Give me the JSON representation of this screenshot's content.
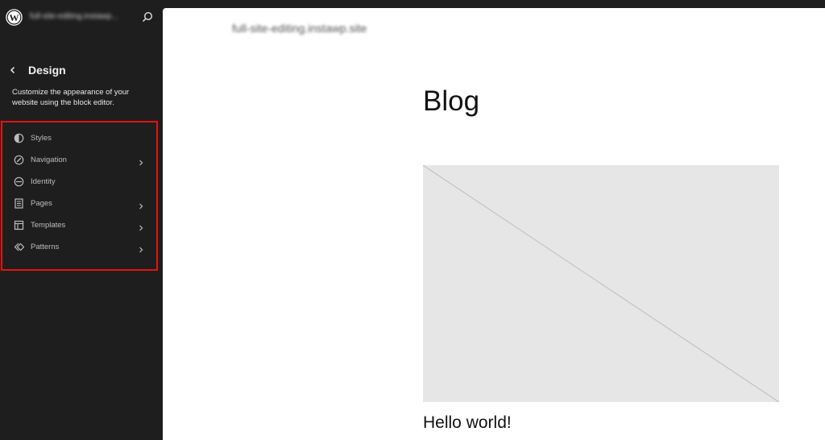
{
  "header": {
    "site_title": "full-site-editing.instawp...",
    "search_icon": "search-icon",
    "logo_icon": "wordpress-logo-icon"
  },
  "sidebar": {
    "back_icon": "chevron-left-icon",
    "title": "Design",
    "description": "Customize the appearance of your website using the block editor.",
    "items": [
      {
        "label": "Styles",
        "icon": "half-circle-icon",
        "has_chevron": false
      },
      {
        "label": "Navigation",
        "icon": "compass-icon",
        "has_chevron": true
      },
      {
        "label": "Identity",
        "icon": "identity-icon",
        "has_chevron": false
      },
      {
        "label": "Pages",
        "icon": "page-icon",
        "has_chevron": true
      },
      {
        "label": "Templates",
        "icon": "layout-icon",
        "has_chevron": true
      },
      {
        "label": "Patterns",
        "icon": "symbol-icon",
        "has_chevron": true
      }
    ]
  },
  "canvas": {
    "site_title": "full-site-editing.instawp.site",
    "page_title": "Blog",
    "post_title": "Hello world!"
  },
  "colors": {
    "sidebar_bg": "#1e1e1e",
    "highlight_border": "#e51212",
    "canvas_bg": "#ffffff",
    "placeholder_bg": "#e6e6e6"
  }
}
